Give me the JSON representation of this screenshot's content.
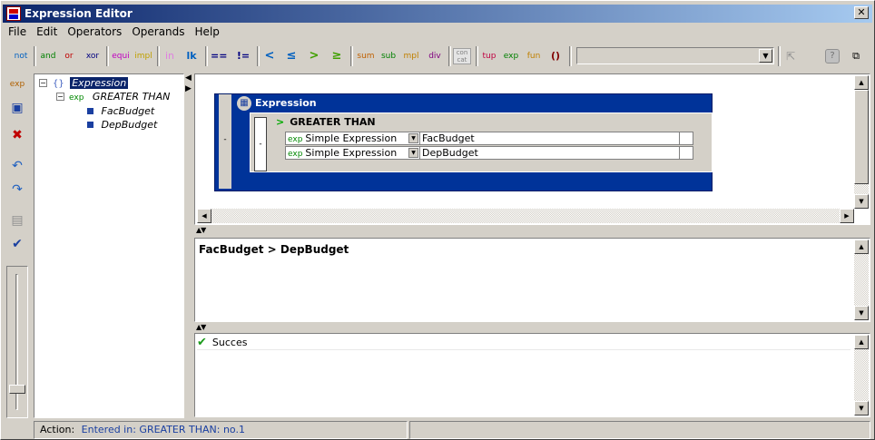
{
  "window": {
    "title": "Expression Editor",
    "close_label": "✕"
  },
  "menu": [
    "File",
    "Edit",
    "Operators",
    "Operands",
    "Help"
  ],
  "toolbar": {
    "buttons": [
      {
        "label": "not",
        "color": "#0060c0"
      },
      {
        "label": "and",
        "color": "#008000"
      },
      {
        "label": "or",
        "color": "#c00000"
      },
      {
        "label": "xor",
        "color": "#000080"
      },
      {
        "label": "equi",
        "color": "#c000c0"
      },
      {
        "label": "impl",
        "color": "#c0a000"
      },
      {
        "label": "in",
        "color": "#e080e0"
      },
      {
        "label": "lk",
        "color": "#0060c0"
      },
      {
        "label": "==",
        "color": "#000080"
      },
      {
        "label": "!=",
        "color": "#000080"
      },
      {
        "label": "<",
        "color": "#0060c0"
      },
      {
        "label": "≤",
        "color": "#0060c0"
      },
      {
        "label": ">",
        "color": "#40a000"
      },
      {
        "label": "≥",
        "color": "#40a000"
      },
      {
        "label": "sum",
        "color": "#c06000"
      },
      {
        "label": "sub",
        "color": "#008000"
      },
      {
        "label": "mpl",
        "color": "#c08000"
      },
      {
        "label": "div",
        "color": "#800080"
      },
      {
        "label": "con cat",
        "color": "#808080"
      },
      {
        "label": "tup",
        "color": "#c00040"
      },
      {
        "label": "exp",
        "color": "#008000"
      },
      {
        "label": "fun",
        "color": "#c08000"
      },
      {
        "label": "()",
        "color": "#800000"
      }
    ],
    "combo_value": ""
  },
  "left_tools": [
    "open-icon",
    "save-icon",
    "delete-icon",
    "undo-icon",
    "redo-icon",
    "evaluate-icon",
    "check-icon"
  ],
  "tree": {
    "root": "Expression",
    "child": "GREATER THAN",
    "child_tag": "exp",
    "leaves": [
      "FacBudget",
      "DepBudget"
    ]
  },
  "canvas": {
    "expression_title": "Expression",
    "operator_title": "GREATER THAN",
    "operator_symbol": ">",
    "side_label": "-",
    "rows": [
      {
        "tag": "exp",
        "type": "Simple Expression",
        "value": "FacBudget"
      },
      {
        "tag": "exp",
        "type": "Simple Expression",
        "value": "DepBudget"
      }
    ]
  },
  "text_output": "FacBudget > DepBudget",
  "status_messages": [
    {
      "icon": "check-icon",
      "text": "Succes"
    }
  ],
  "statusbar": {
    "action_label": "Action:",
    "action_value": "Entered in: GREATER THAN: no.1"
  }
}
